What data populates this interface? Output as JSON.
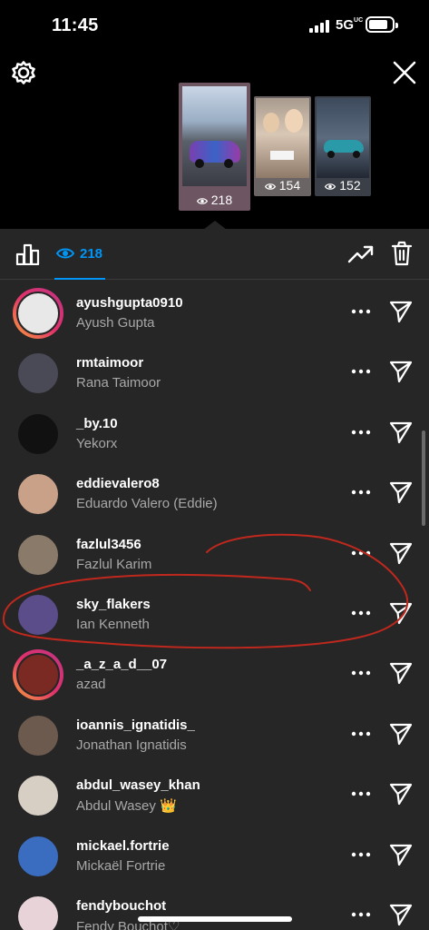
{
  "status_bar": {
    "time": "11:45",
    "network": "5G",
    "network_sup": "UC"
  },
  "icons": {
    "settings": "gear-icon",
    "close": "close-icon",
    "stats": "bar-chart-icon",
    "eye": "eye-icon",
    "trend": "trend-icon",
    "trash": "trash-icon",
    "more": "more-icon",
    "send": "send-icon"
  },
  "stories": [
    {
      "views": "218",
      "selected": true
    },
    {
      "views": "154",
      "selected": false
    },
    {
      "views": "152",
      "selected": false
    }
  ],
  "header": {
    "view_count": "218"
  },
  "viewers": [
    {
      "username": "ayushgupta0910",
      "full_name": "Ayush Gupta",
      "story_ring": true,
      "avatar_color": "#e8e8e8"
    },
    {
      "username": "rmtaimoor",
      "full_name": "Rana Taimoor",
      "story_ring": false,
      "avatar_color": "#4a4a56"
    },
    {
      "username": "_by.10",
      "full_name": "Yekorx",
      "story_ring": false,
      "avatar_color": "#111111"
    },
    {
      "username": "eddievalero8",
      "full_name": "Eduardo Valero (Eddie)",
      "story_ring": false,
      "avatar_color": "#c9a189"
    },
    {
      "username": "fazlul3456",
      "full_name": "Fazlul Karim",
      "story_ring": false,
      "avatar_color": "#8a7a6a"
    },
    {
      "username": "sky_flakers",
      "full_name": "Ian Kenneth",
      "story_ring": false,
      "avatar_color": "#5a4d8a"
    },
    {
      "username": "_a_z_a_d__07",
      "full_name": "azad",
      "story_ring": true,
      "avatar_color": "#7a2a22"
    },
    {
      "username": "ioannis_ignatidis_",
      "full_name": "Jonathan Ignatidis",
      "story_ring": false,
      "avatar_color": "#6d5a4f"
    },
    {
      "username": "abdul_wasey_khan",
      "full_name": "Abdul Wasey 👑",
      "story_ring": false,
      "avatar_color": "#d8cfc4"
    },
    {
      "username": "mickael.fortrie",
      "full_name": "Mickaël Fortrie",
      "story_ring": false,
      "avatar_color": "#3a6cc0"
    },
    {
      "username": "fendybouchot",
      "full_name": "Fendy Bouchot♡",
      "story_ring": false,
      "avatar_color": "#e8d4d8"
    }
  ],
  "colors": {
    "accent": "#0095f6",
    "sheet_bg": "#262626",
    "annotation": "#c0281e"
  }
}
